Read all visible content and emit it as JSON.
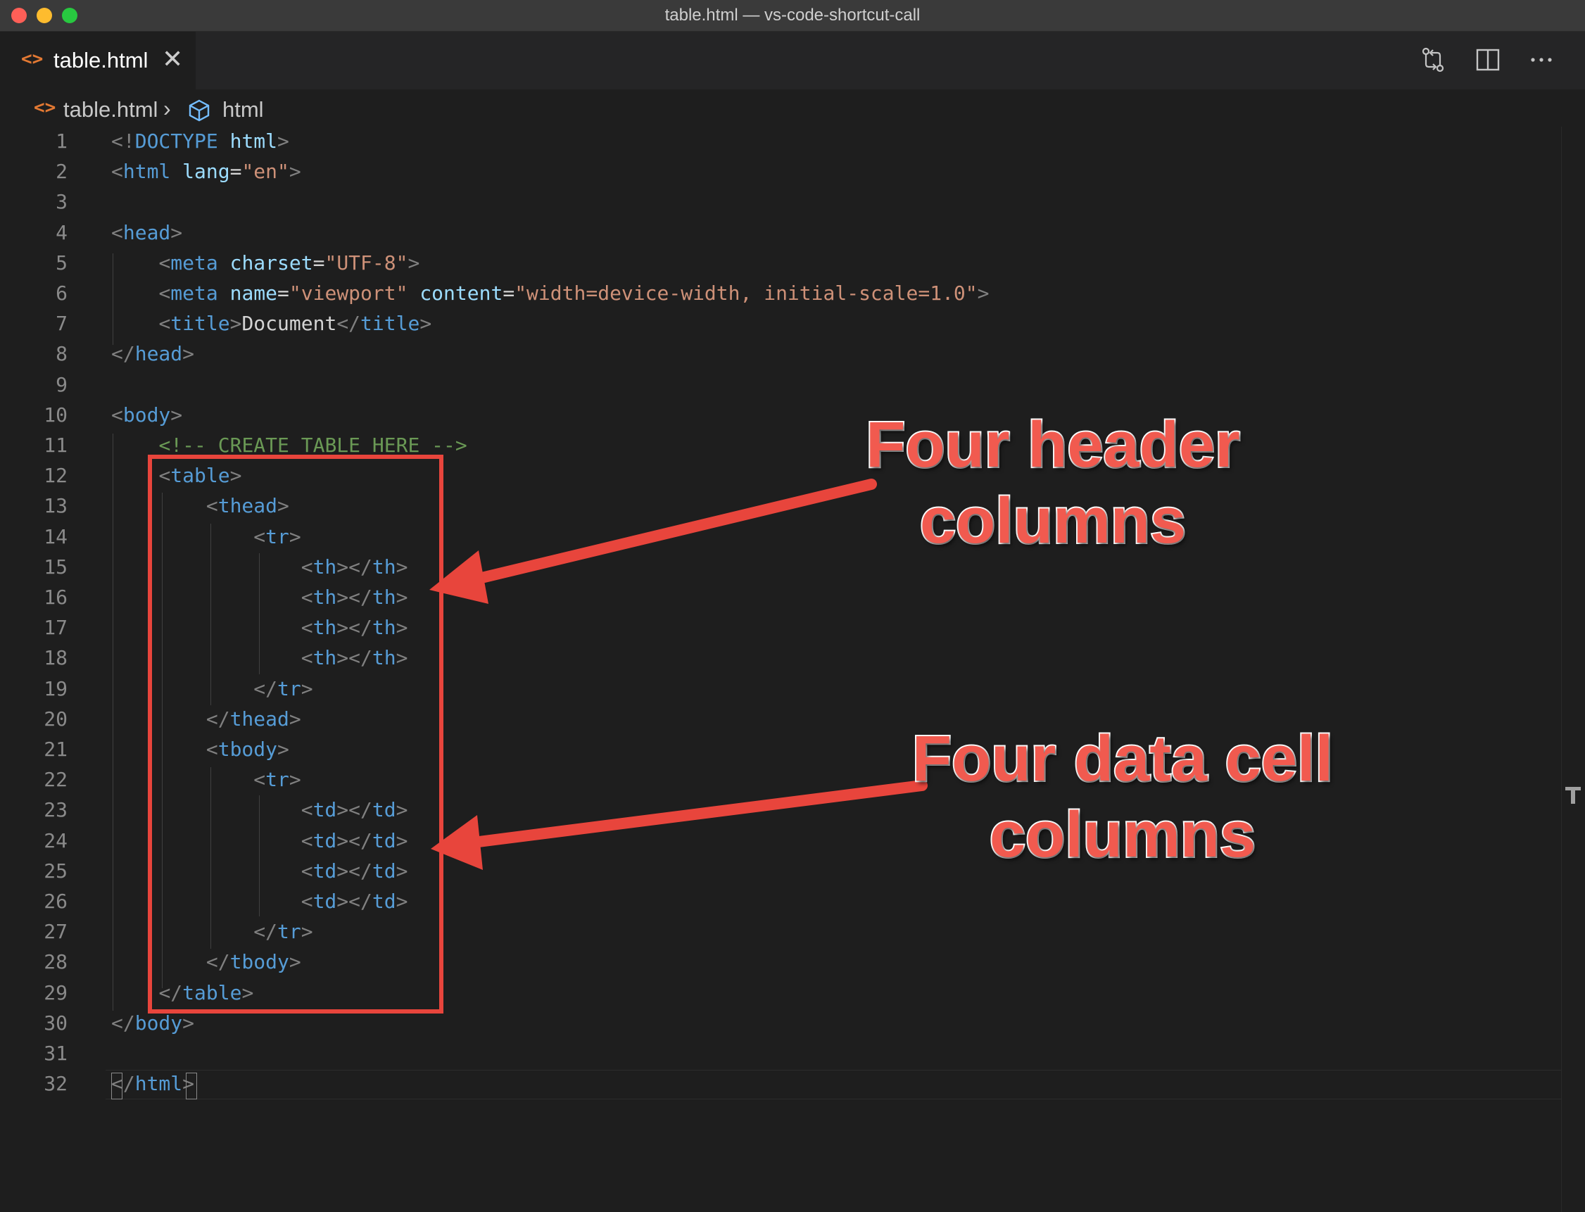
{
  "window": {
    "title": "table.html — vs-code-shortcut-call"
  },
  "tab": {
    "icon": "html-file-icon",
    "label": "table.html",
    "close_glyph": "✕"
  },
  "editor_actions": [
    "source-control-compare-icon",
    "split-editor-icon",
    "more-actions-icon"
  ],
  "breadcrumb": {
    "file": "table.html",
    "separator": "›",
    "symbol_icon": "cube-symbol-icon",
    "symbol": "html"
  },
  "code_lines": [
    "<!DOCTYPE html>",
    "<html lang=\"en\">",
    "",
    "<head>",
    "    <meta charset=\"UTF-8\">",
    "    <meta name=\"viewport\" content=\"width=device-width, initial-scale=1.0\">",
    "    <title>Document</title>",
    "</head>",
    "",
    "<body>",
    "    <!-- CREATE TABLE HERE -->",
    "    <table>",
    "        <thead>",
    "            <tr>",
    "                <th></th>",
    "                <th></th>",
    "                <th></th>",
    "                <th></th>",
    "            </tr>",
    "        </thead>",
    "        <tbody>",
    "            <tr>",
    "                <td></td>",
    "                <td></td>",
    "                <td></td>",
    "                <td></td>",
    "            </tr>",
    "        </tbody>",
    "    </table>",
    "</body>",
    "",
    "</html>"
  ],
  "annotations": {
    "header": {
      "line1": "Four header",
      "line2": "columns"
    },
    "data": {
      "line1": "Four data cell",
      "line2": "columns"
    }
  },
  "colors": {
    "background": "#1e1e1e",
    "tag": "#569cd6",
    "attribute": "#9cdcfe",
    "string": "#ce9178",
    "comment": "#6a9955",
    "annotation": "#f15a4f"
  }
}
